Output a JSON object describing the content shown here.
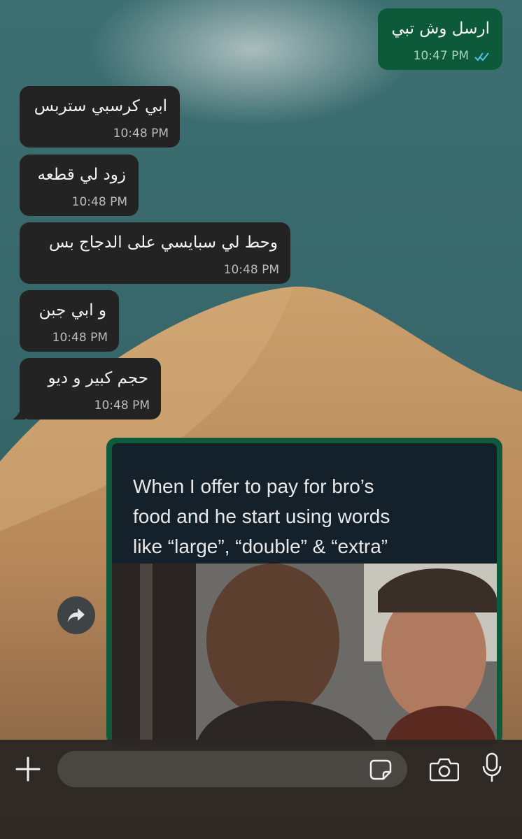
{
  "chat": {
    "messages": [
      {
        "direction": "outgoing",
        "text": "ارسل وش تبي",
        "time": "10:47 PM",
        "status": "read"
      },
      {
        "direction": "incoming",
        "text": "ابي كرسبي ستربس",
        "time": "10:48 PM"
      },
      {
        "direction": "incoming",
        "text": "زود لي قطعه",
        "time": "10:48 PM"
      },
      {
        "direction": "incoming",
        "text": "وحط لي سبايسي على الدجاج بس",
        "time": "10:48 PM"
      },
      {
        "direction": "incoming",
        "text": "و ابي جبن",
        "time": "10:48 PM"
      },
      {
        "direction": "incoming",
        "text": "حجم كبير و ديو",
        "time": "10:48 PM"
      }
    ],
    "image_message": {
      "caption_lines": [
        "When I offer to pay for bro’s",
        "food and he start using words",
        "like “large”, “double” & “extra”"
      ]
    }
  },
  "icons": {
    "forward": "forward-arrow-icon",
    "attach": "plus-icon",
    "sticker": "sticker-icon",
    "camera": "camera-icon",
    "mic": "microphone-icon",
    "read_ticks": "double-check-icon"
  },
  "colors": {
    "incoming_bubble": "#232323",
    "outgoing_bubble": "#0c5a3a",
    "read_ticks": "#53bdeb"
  }
}
